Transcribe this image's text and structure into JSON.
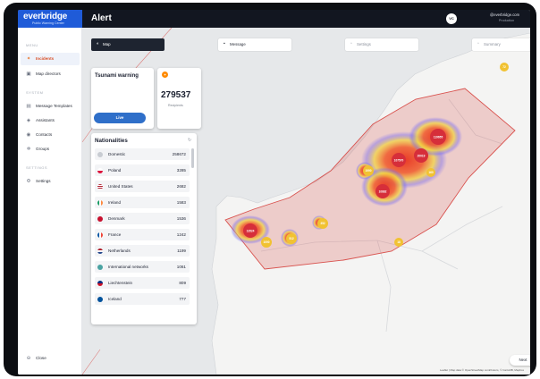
{
  "app": {
    "logo_name": "everbridge",
    "logo_sub": "Public Warning Center",
    "page_title": "Alert",
    "user_initials": "VC",
    "user_email": "@everbridge.com",
    "user_role": "Production"
  },
  "sidebar": {
    "sections": [
      {
        "title": "MENU",
        "items": [
          {
            "label": "Incidents",
            "icon": "bell-icon",
            "active": true
          },
          {
            "label": "Map directors",
            "icon": "map-icon",
            "active": false
          }
        ]
      },
      {
        "title": "SYSTEM",
        "items": [
          {
            "label": "Message Templates",
            "icon": "template-icon",
            "active": false
          },
          {
            "label": "Assistants",
            "icon": "assistant-icon",
            "active": false
          },
          {
            "label": "Contacts",
            "icon": "contacts-icon",
            "active": false
          },
          {
            "label": "Groups",
            "icon": "groups-icon",
            "active": false
          }
        ]
      },
      {
        "title": "SETTINGS",
        "items": [
          {
            "label": "Settings",
            "icon": "gear-icon",
            "active": false
          }
        ]
      }
    ],
    "close_label": "Close"
  },
  "toolbar": {
    "map_label": "Map",
    "message_label": "Message",
    "settings_label": "Settings",
    "summary_label": "Summary"
  },
  "alert_card": {
    "title": "Tsunami warning",
    "live_label": "Live"
  },
  "count_card": {
    "value": "279537",
    "label": "Recipients"
  },
  "nationalities": {
    "title": "Nationalities",
    "rows": [
      {
        "name": "Domestic",
        "count": "258672",
        "flag": "domestic"
      },
      {
        "name": "Poland",
        "count": "3285",
        "flag": "poland"
      },
      {
        "name": "United States",
        "count": "2682",
        "flag": "usa"
      },
      {
        "name": "Ireland",
        "count": "1583",
        "flag": "ireland"
      },
      {
        "name": "Denmark",
        "count": "1536",
        "flag": "denmark"
      },
      {
        "name": "France",
        "count": "1242",
        "flag": "france"
      },
      {
        "name": "Netherlands",
        "count": "1199",
        "flag": "netherlands"
      },
      {
        "name": "International networks",
        "count": "1061",
        "flag": "globe"
      },
      {
        "name": "Liechtenstein",
        "count": "809",
        "flag": "liechtenstein"
      },
      {
        "name": "Iceland",
        "count": "777",
        "flag": "iceland"
      }
    ]
  },
  "map": {
    "clusters": [
      {
        "label": "119655",
        "color": "#d62e3a"
      },
      {
        "label": "107570",
        "color": "#d62e3a"
      },
      {
        "label": "20019",
        "color": "#d62e3a"
      },
      {
        "label": "13524",
        "color": "#d62e3a"
      },
      {
        "label": "10882",
        "color": "#d62e3a"
      },
      {
        "label": "1990",
        "color": "#f1c232"
      },
      {
        "label": "1090",
        "color": "#f1c232"
      },
      {
        "label": "512",
        "color": "#f1c232"
      },
      {
        "label": "352",
        "color": "#f1c232"
      },
      {
        "label": "160",
        "color": "#f1c232"
      },
      {
        "label": "72",
        "color": "#f1c232"
      },
      {
        "label": "18",
        "color": "#f1c232"
      }
    ],
    "next_label": "Next",
    "attribution": "Leaflet | Map data © OpenStreetMap contributors, © CartoDB, Mapbox"
  },
  "colors": {
    "brand": "#1f5bd8",
    "accent": "#e8762b",
    "live_button": "#2f6fc9",
    "polygon": "#d9534f"
  }
}
